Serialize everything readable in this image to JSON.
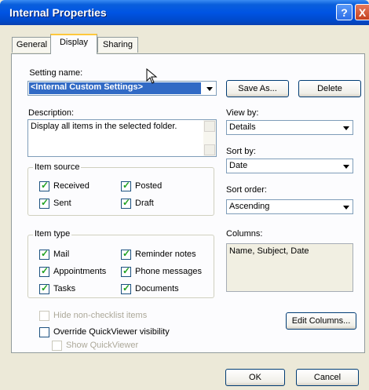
{
  "window": {
    "title": "Internal Properties",
    "help_label": "?",
    "close_label": "X"
  },
  "tabs": [
    "General",
    "Display",
    "Sharing"
  ],
  "setting_name": {
    "label": "Setting name:",
    "value": "<Internal Custom Settings>"
  },
  "buttons": {
    "save_as": "Save As...",
    "delete": "Delete",
    "edit_columns": "Edit Columns...",
    "ok": "OK",
    "cancel": "Cancel"
  },
  "description": {
    "label": "Description:",
    "text": "Display all items in the selected folder."
  },
  "view_by": {
    "label": "View by:",
    "value": "Details"
  },
  "sort_by": {
    "label": "Sort by:",
    "value": "Date"
  },
  "sort_order": {
    "label": "Sort order:",
    "value": "Ascending"
  },
  "item_source": {
    "title": "Item source",
    "items": [
      {
        "label": "Received",
        "checked": true
      },
      {
        "label": "Posted",
        "checked": true
      },
      {
        "label": "Sent",
        "checked": true
      },
      {
        "label": "Draft",
        "checked": true
      }
    ]
  },
  "item_type": {
    "title": "Item type",
    "items": [
      {
        "label": "Mail",
        "checked": true
      },
      {
        "label": "Reminder notes",
        "checked": true
      },
      {
        "label": "Appointments",
        "checked": true
      },
      {
        "label": "Phone messages",
        "checked": true
      },
      {
        "label": "Tasks",
        "checked": true
      },
      {
        "label": "Documents",
        "checked": true
      }
    ]
  },
  "columns": {
    "label": "Columns:",
    "value": "Name, Subject, Date"
  },
  "options": {
    "hide_non_checklist": "Hide non-checklist items",
    "override_quickviewer": "Override QuickViewer visibility",
    "show_quickviewer": "Show QuickViewer"
  },
  "colors": {
    "title_bar": "#0054e3",
    "selection": "#316ac5",
    "tab_highlight": "#ffc83c",
    "dialog_bg": "#ece9d8"
  }
}
